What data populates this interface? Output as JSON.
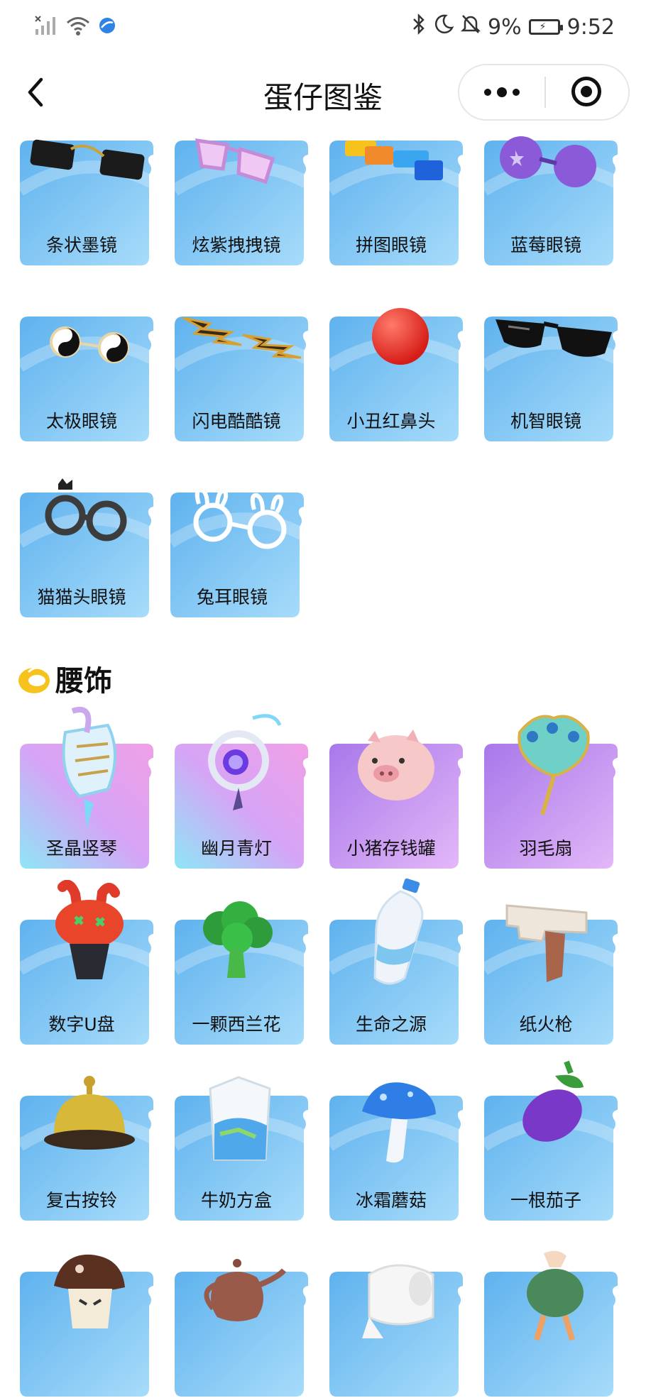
{
  "status_bar": {
    "battery": "9%",
    "time": "9:52"
  },
  "nav": {
    "title": "蛋仔图鉴"
  },
  "glasses": [
    {
      "label": "条状墨镜"
    },
    {
      "label": "炫紫拽拽镜"
    },
    {
      "label": "拼图眼镜"
    },
    {
      "label": "蓝莓眼镜"
    },
    {
      "label": "太极眼镜"
    },
    {
      "label": "闪电酷酷镜"
    },
    {
      "label": "小丑红鼻头"
    },
    {
      "label": "机智眼镜"
    },
    {
      "label": "猫猫头眼镜"
    },
    {
      "label": "兔耳眼镜"
    }
  ],
  "waist": {
    "title": "腰饰",
    "items": [
      {
        "label": "圣晶竖琴"
      },
      {
        "label": "幽月青灯"
      },
      {
        "label": "小猪存钱罐"
      },
      {
        "label": "羽毛扇"
      },
      {
        "label": "数字U盘"
      },
      {
        "label": "一颗西兰花"
      },
      {
        "label": "生命之源"
      },
      {
        "label": "纸火枪"
      },
      {
        "label": "复古按铃"
      },
      {
        "label": "牛奶方盒"
      },
      {
        "label": "冰霜蘑菇"
      },
      {
        "label": "一根茄子"
      }
    ]
  },
  "colors": {
    "card_blue": "#8ccff6",
    "card_purple": "#c79af0",
    "accent_yellow": "#f6c21c"
  }
}
